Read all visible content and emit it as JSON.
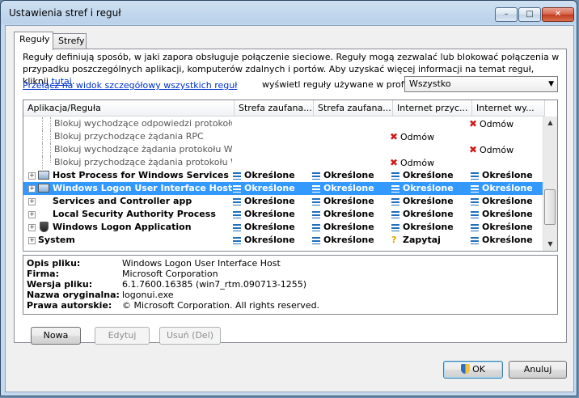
{
  "window": {
    "title": "Ustawienia stref i reguł",
    "min": "–",
    "max": "□",
    "close": "✕"
  },
  "tabs": [
    {
      "label": "Reguły"
    },
    {
      "label": "Strefy"
    }
  ],
  "description": {
    "text": "Reguły definiują sposób, w jaki zapora obsługuje połączenie sieciowe. Reguły mogą zezwalać lub blokować połączenia w przypadku poszczególnych aplikacji, komputerów zdalnych i portów. Aby uzyskać więcej informacji na temat reguł, kliknij ",
    "link": "tutaj",
    "end": "."
  },
  "detail_link": "Przełącz na widok szczegółowy wszystkich reguł",
  "profile": {
    "label": "wyświetl reguły używane w profilu:",
    "selected": "Wszystko",
    "arrow": "▼"
  },
  "columns": [
    "Aplikacja/Reguła",
    "Strefa zaufana...",
    "Strefa zaufana...",
    "Internet przyc...",
    "Internet wy..."
  ],
  "rows": [
    {
      "name": "Blokuj wychodzące odpowiedzi protokołu IC...",
      "c1": "",
      "c2": "",
      "c3": "",
      "c4": "Odmów",
      "c3_icon": "",
      "c4_icon": "deny-icon"
    },
    {
      "name": "Blokuj przychodzące żądania RPC",
      "c1": "",
      "c2": "",
      "c3": "Odmów",
      "c4": "",
      "c3_icon": "deny-icon",
      "c4_icon": ""
    },
    {
      "name": "Blokuj wychodzące żądania protokołu Web ...",
      "c1": "",
      "c2": "",
      "c3": "",
      "c4": "Odmów",
      "c3_icon": "",
      "c4_icon": "deny-icon"
    },
    {
      "name": "Blokuj przychodzące żądania protokołu We...",
      "c1": "",
      "c2": "",
      "c3": "Odmów",
      "c4": "",
      "c3_icon": "deny-icon",
      "c4_icon": ""
    },
    {
      "name": "Host Process for Windows Services",
      "c1": "Określone",
      "c2": "Określone",
      "c3": "Określone",
      "c4": "Określone"
    },
    {
      "name": "Windows Logon User Interface Host",
      "c1": "Określone",
      "c2": "Określone",
      "c3": "Określone",
      "c4": "Określone",
      "selected": true
    },
    {
      "name": "Services and Controller app",
      "c1": "Określone",
      "c2": "Określone",
      "c3": "Określone",
      "c4": "Określone"
    },
    {
      "name": "Local Security Authority Process",
      "c1": "Określone",
      "c2": "Określone",
      "c3": "Określone",
      "c4": "Określone"
    },
    {
      "name": "Windows Logon Application",
      "c1": "Określone",
      "c2": "Określone",
      "c3": "Określone",
      "c4": "Określone"
    },
    {
      "name": "System",
      "c1": "Określone",
      "c2": "Określone",
      "c3": "Zapytaj",
      "c4": "Określone"
    }
  ],
  "scrollbar": {
    "up": "▲",
    "down": "▼"
  },
  "file_info": [
    {
      "label": "Opis pliku:",
      "value": "Windows Logon User Interface Host"
    },
    {
      "label": "Firma:",
      "value": "Microsoft Corporation"
    },
    {
      "label": "Wersja pliku:",
      "value": "6.1.7600.16385 (win7_rtm.090713-1255)"
    },
    {
      "label": "Nazwa oryginalna:",
      "value": "logonui.exe"
    },
    {
      "label": "Prawa autorskie:",
      "value": "© Microsoft Corporation. All rights reserved."
    }
  ],
  "buttons": {
    "new": "Nowa",
    "edit": "Edytuj",
    "remove": "Usuń (Del)",
    "ok": "OK",
    "cancel": "Anuluj"
  },
  "glyphs": {
    "deny": "✖",
    "ask": "?",
    "expand": "+"
  },
  "colors": {
    "selection": "#3399ff",
    "link": "#0033cc",
    "deny": "#d21c1c",
    "ask": "#e0a000",
    "defined": "#1f6fbf"
  }
}
